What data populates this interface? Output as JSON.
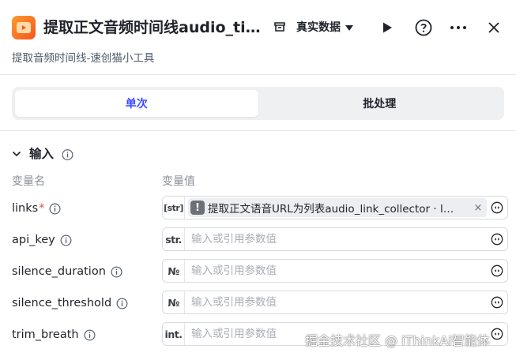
{
  "header": {
    "title": "提取正文音频时间线audio_ti…",
    "data_mode": "真实数据",
    "subtitle": "提取音频时间线-速创猫小工具"
  },
  "tabs": [
    {
      "label": "单次",
      "active": true
    },
    {
      "label": "批处理",
      "active": false
    }
  ],
  "input_section": {
    "title": "输入",
    "col_name": "变量名",
    "col_value": "变量值",
    "params": [
      {
        "name": "links",
        "required": true,
        "type": "[str]",
        "chip": "提取正文语音URL为列表audio_link_collector · l…"
      },
      {
        "name": "api_key",
        "required": false,
        "type": "str.",
        "placeholder": "输入或引用参数值"
      },
      {
        "name": "silence_duration",
        "required": false,
        "type": "№",
        "placeholder": "输入或引用参数值"
      },
      {
        "name": "silence_threshold",
        "required": false,
        "type": "№",
        "placeholder": "输入或引用参数值"
      },
      {
        "name": "trim_breath",
        "required": false,
        "type": "int.",
        "placeholder": "输入或引用参数值"
      }
    ]
  },
  "watermark": "掘金技术社区 @ iThinkAi智能体",
  "colors": {
    "accent": "#3b4bff",
    "app_icon": "#f5541f",
    "required": "#e5484d"
  },
  "icons": [
    "app-logo-icon",
    "data-source-icon",
    "run-icon",
    "help-icon",
    "more-icon",
    "close-icon",
    "chevron-down-icon",
    "info-icon",
    "reference-icon",
    "warning-icon"
  ]
}
